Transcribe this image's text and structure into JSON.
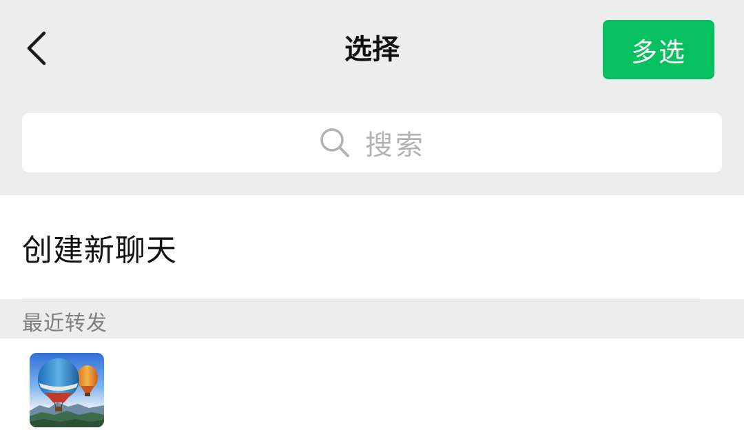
{
  "header": {
    "back_icon": "chevron-left-icon",
    "title": "选择",
    "multi_select_label": "多选",
    "accent_color": "#07c160"
  },
  "search": {
    "icon": "search-icon",
    "placeholder": "搜索"
  },
  "actions": {
    "new_chat_label": "创建新聊天"
  },
  "recent": {
    "section_title": "最近转发",
    "items": [
      {
        "avatar": "hot-air-balloons-avatar"
      }
    ]
  }
}
